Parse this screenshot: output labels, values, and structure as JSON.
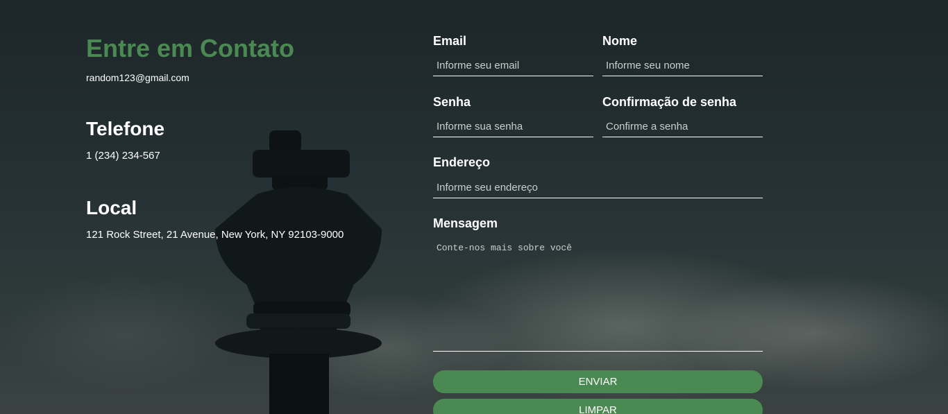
{
  "contact": {
    "title": "Entre em Contato",
    "email": "random123@gmail.com",
    "phone_heading": "Telefone",
    "phone": "1 (234) 234-567",
    "location_heading": "Local",
    "address": "121 Rock Street, 21 Avenue, New York, NY 92103-9000"
  },
  "form": {
    "email_label": "Email",
    "email_placeholder": "Informe seu email",
    "name_label": "Nome",
    "name_placeholder": "Informe seu nome",
    "password_label": "Senha",
    "password_placeholder": "Informe sua senha",
    "confirm_label": "Confirmação de senha",
    "confirm_placeholder": "Confirme a senha",
    "address_label": "Endereço",
    "address_placeholder": "Informe seu endereço",
    "message_label": "Mensagem",
    "message_placeholder": "Conte-nos mais sobre você",
    "submit_label": "ENVIAR",
    "clear_label": "LIMPAR"
  },
  "colors": {
    "accent": "#4a8a52",
    "background": "#1f2a2c"
  }
}
